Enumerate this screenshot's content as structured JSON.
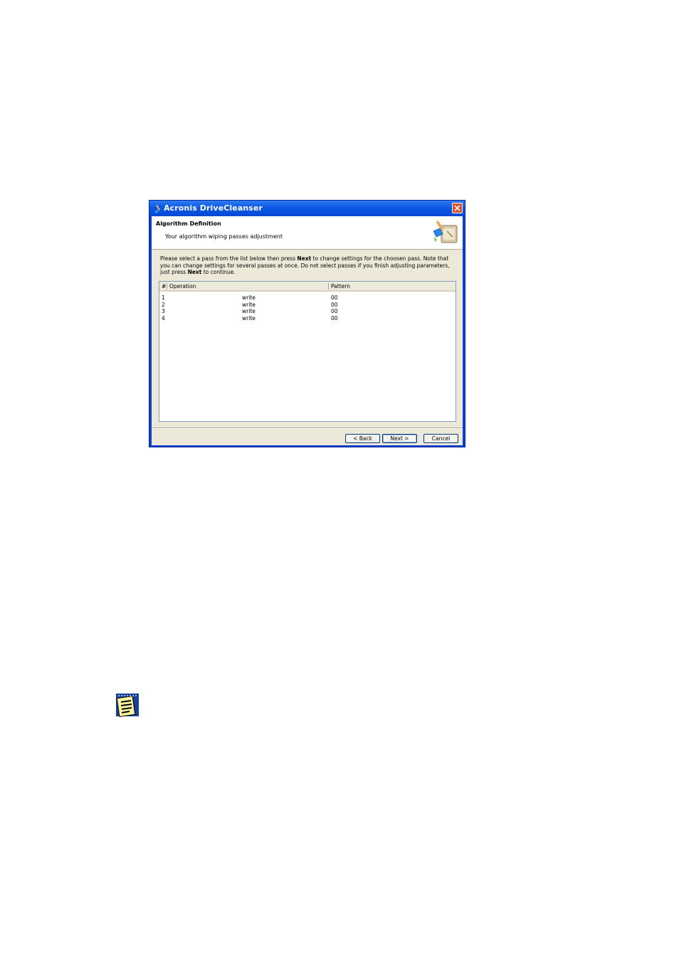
{
  "window": {
    "title": "Acronis DriveCleanser"
  },
  "header": {
    "title": "Algorithm Definition",
    "subtitle": "Your algorithm wiping passes adjustment"
  },
  "instructions": {
    "part1": "Please select a pass from the list below then press ",
    "bold1": "Next",
    "part2": " to change settings for the choosen pass. Note that you can change settings for several passes at once. Do not select passes if you finish adjusting parameters, just press ",
    "bold2": "Next",
    "part3": " to continue."
  },
  "list": {
    "columns": [
      "#",
      "Operation",
      "Pattern"
    ],
    "rows": [
      {
        "num": "1",
        "operation": "write",
        "pattern": "00"
      },
      {
        "num": "2",
        "operation": "write",
        "pattern": "00"
      },
      {
        "num": "3",
        "operation": "write",
        "pattern": "00"
      },
      {
        "num": "4",
        "operation": "write",
        "pattern": "00"
      }
    ]
  },
  "buttons": {
    "back": "< Back",
    "next": "Next >",
    "cancel": "Cancel"
  },
  "icons": {
    "app": "brush-icon",
    "wizard": "wizard-brush-icon",
    "close": "close-icon",
    "note": "note-icon"
  },
  "colors": {
    "titlebar": "#0a57e3",
    "close": "#d9502e",
    "dialog_bg": "#ece9d8"
  }
}
